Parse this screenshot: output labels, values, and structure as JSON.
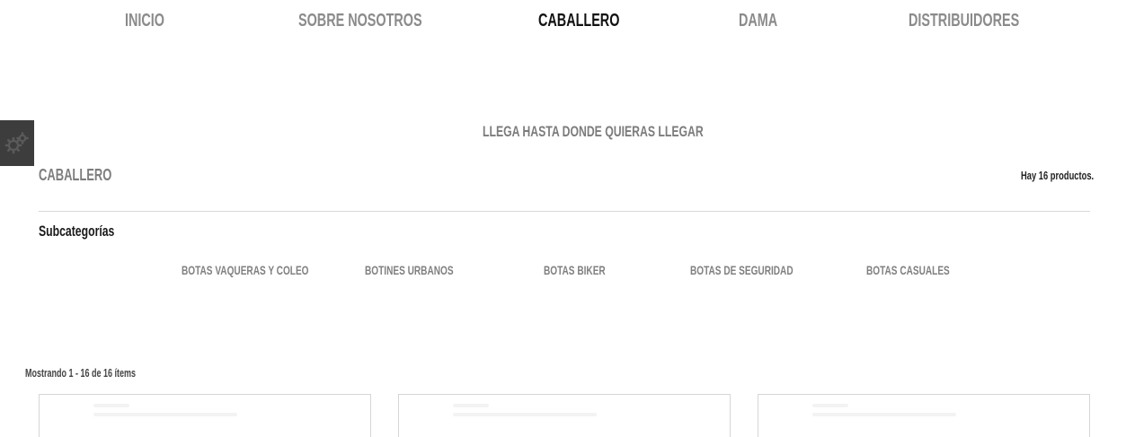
{
  "nav": {
    "items": [
      {
        "label": "INICIO"
      },
      {
        "label": "SOBRE NOSOTROS"
      },
      {
        "label": "CABALLERO"
      },
      {
        "label": "DAMA"
      },
      {
        "label": "DISTRIBUIDORES"
      }
    ],
    "active": "CABALLERO"
  },
  "settings": {
    "icon": "gears-icon"
  },
  "tagline": "LLEGA HASTA DONDE QUIERAS LLEGAR",
  "category": {
    "title": "CABALLERO",
    "product_count": "Hay 16 productos."
  },
  "subcategories": {
    "heading": "Subcategorías",
    "items": [
      {
        "label": "BOTAS VAQUERAS Y COLEO"
      },
      {
        "label": "BOTINES URBANOS"
      },
      {
        "label": "BOTAS BIKER"
      },
      {
        "label": "BOTAS DE SEGURIDAD"
      },
      {
        "label": "BOTAS CASUALES"
      }
    ]
  },
  "listing": {
    "showing": "Mostrando 1 - 16 de 16 ítems"
  },
  "colors": {
    "nav_inactive": "#8b8b8b",
    "nav_active": "#111111",
    "settings_bg": "#3d3d3d",
    "divider": "#d9d9d9",
    "card_border": "#d6d6d6"
  }
}
